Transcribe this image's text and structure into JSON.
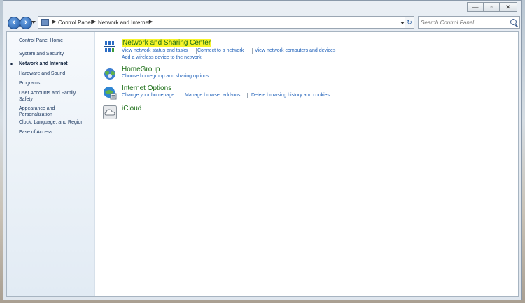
{
  "window": {
    "minimize_glyph": "—",
    "maximize_glyph": "▫",
    "close_glyph": "✕"
  },
  "toolbar": {
    "back_glyph": "‹",
    "forward_glyph": "›",
    "refresh_glyph": "↻",
    "breadcrumbs": [
      "Control Panel",
      "Network and Internet"
    ],
    "search_placeholder": "Search Control Panel"
  },
  "sidebar": {
    "items": [
      {
        "label": "Control Panel Home",
        "active": false
      },
      {
        "label": "System and Security",
        "active": false
      },
      {
        "label": "Network and Internet",
        "active": true
      },
      {
        "label": "Hardware and Sound",
        "active": false
      },
      {
        "label": "Programs",
        "active": false
      },
      {
        "label": "User Accounts and Family Safety",
        "active": false
      },
      {
        "label": "Appearance and Personalization",
        "active": false
      },
      {
        "label": "Clock, Language, and Region",
        "active": false
      },
      {
        "label": "Ease of Access",
        "active": false
      }
    ]
  },
  "categories": [
    {
      "title": "Network and Sharing Center",
      "highlighted": true,
      "icon": "network-icon",
      "links": [
        "View network status and tasks",
        "Connect to a network",
        "View network computers and devices",
        "Add a wireless device to the network"
      ]
    },
    {
      "title": "HomeGroup",
      "highlighted": false,
      "icon": "homegroup-icon",
      "links": [
        "Choose homegroup and sharing options"
      ]
    },
    {
      "title": "Internet Options",
      "highlighted": false,
      "icon": "internet-options-icon",
      "links": [
        "Change your homepage",
        "Manage browser add-ons",
        "Delete browsing history and cookies"
      ]
    },
    {
      "title": "iCloud",
      "highlighted": false,
      "icon": "icloud-icon",
      "links": []
    }
  ],
  "colors": {
    "link": "#1d5fb8",
    "category_title": "#1c6e16",
    "highlight": "#f7f42a"
  }
}
